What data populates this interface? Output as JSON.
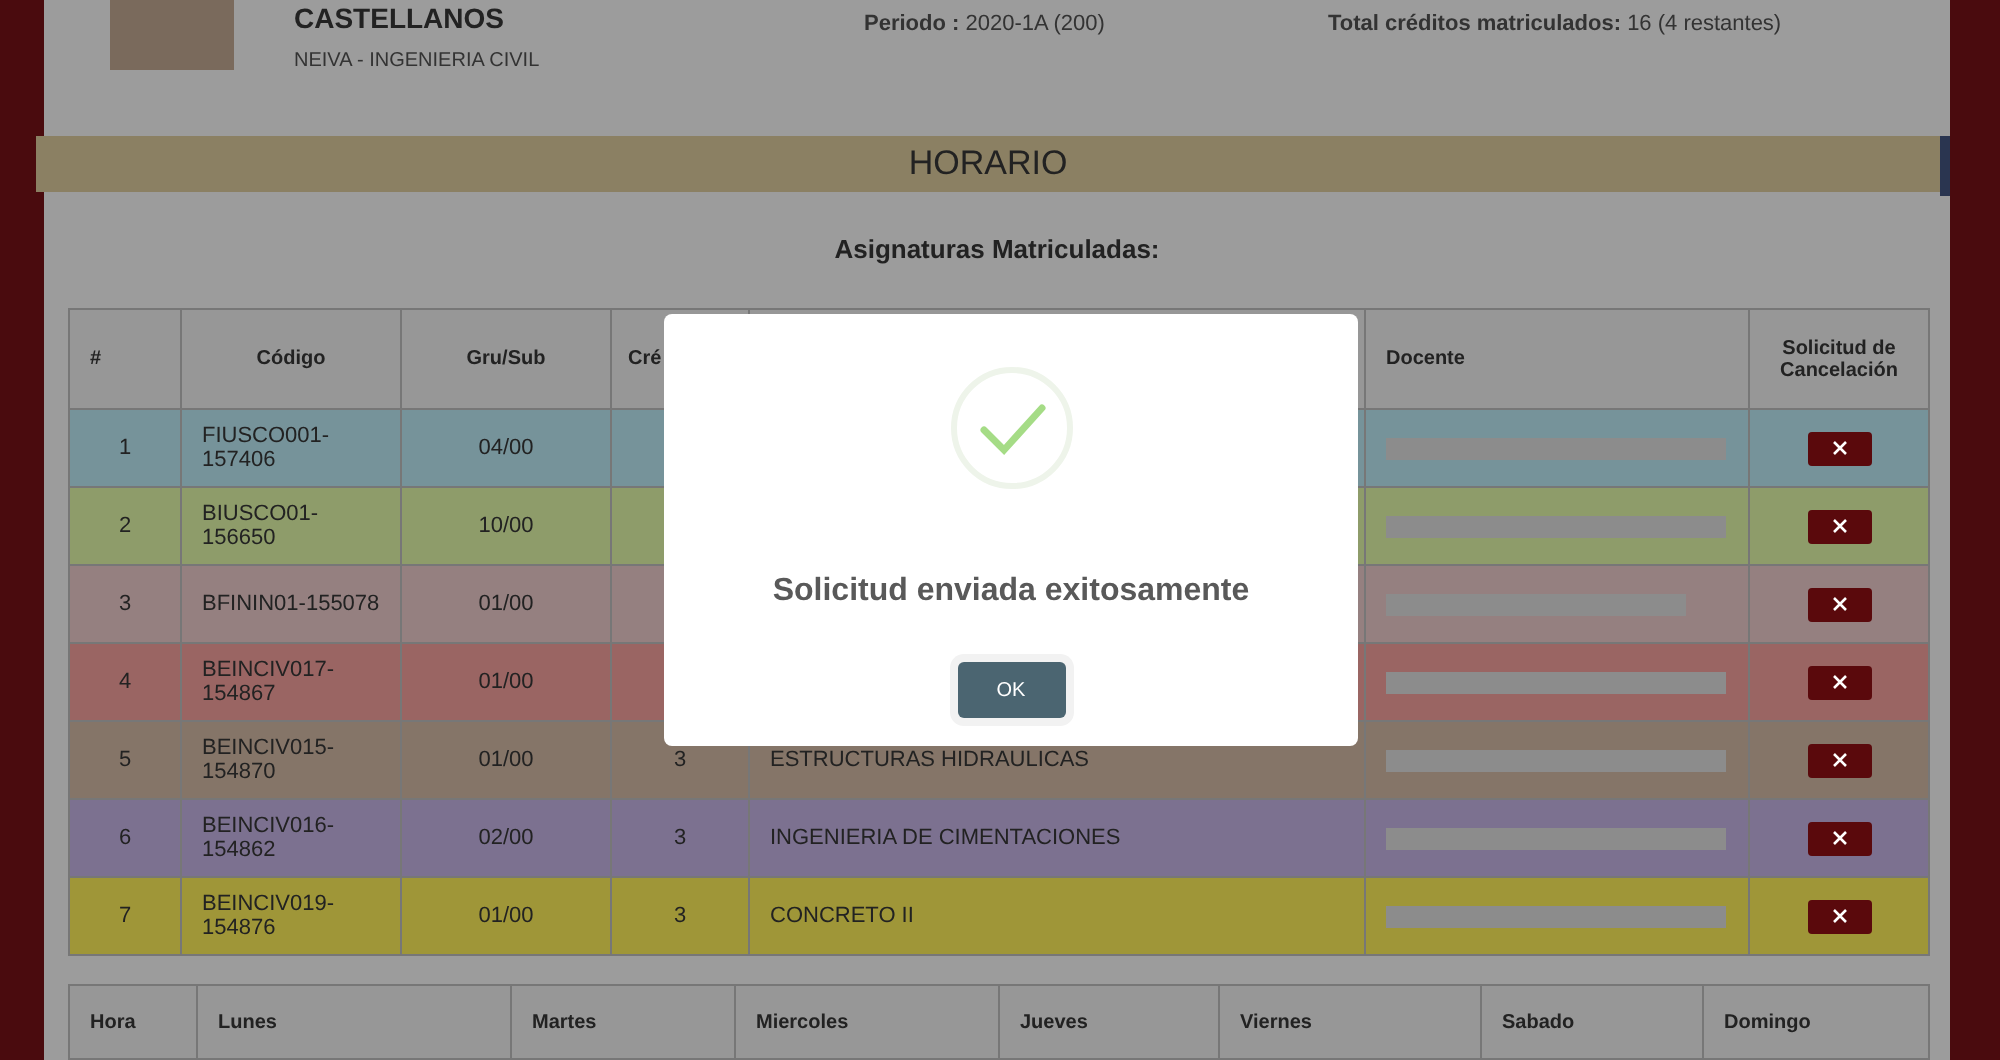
{
  "student": {
    "name": "CASTELLANOS",
    "program": "NEIVA - INGENIERIA CIVIL",
    "period_label": "Periodo :",
    "period_value": "2020-1A (200)",
    "credits_label": "Total créditos matriculados:",
    "credits_value": "16 (4 restantes)"
  },
  "section_title": "HORARIO",
  "subjects_title": "Asignaturas Matriculadas:",
  "table": {
    "columns": [
      "#",
      "Código",
      "Gru/Sub",
      "Cré",
      "Docente",
      "Solicitud de Cancelación"
    ],
    "rows": [
      {
        "number": "1",
        "code": "FIUSCO001-157406",
        "group": "04/00",
        "color": "#76939a"
      },
      {
        "number": "2",
        "code": "BIUSCO01-156650",
        "group": "10/00",
        "color": "#8e9c6a"
      },
      {
        "number": "3",
        "code": "BFININ01-155078",
        "group": "01/00",
        "color": "#958080"
      },
      {
        "number": "4",
        "code": "BEINCIV017-154867",
        "group": "01/00",
        "color": "#9a6563"
      },
      {
        "number": "5",
        "code": "BEINCIV015-154870",
        "group": "01/00",
        "credits": "3",
        "subject": "ESTRUCTURAS HIDRAULICAS",
        "color": "#857568"
      },
      {
        "number": "6",
        "code": "BEINCIV016-154862",
        "group": "02/00",
        "credits": "3",
        "subject": "INGENIERIA DE CIMENTACIONES",
        "color": "#7c7190"
      },
      {
        "number": "7",
        "code": "BEINCIV019-154876",
        "group": "01/00",
        "credits": "3",
        "subject": "CONCRETO II",
        "color": "#9f9638"
      }
    ]
  },
  "schedule": {
    "columns": [
      "Hora",
      "Lunes",
      "Martes",
      "Miercoles",
      "Jueves",
      "Viernes",
      "Sabado",
      "Domingo"
    ]
  },
  "dialog": {
    "message": "Solicitud enviada exitosamente",
    "button": "OK"
  }
}
